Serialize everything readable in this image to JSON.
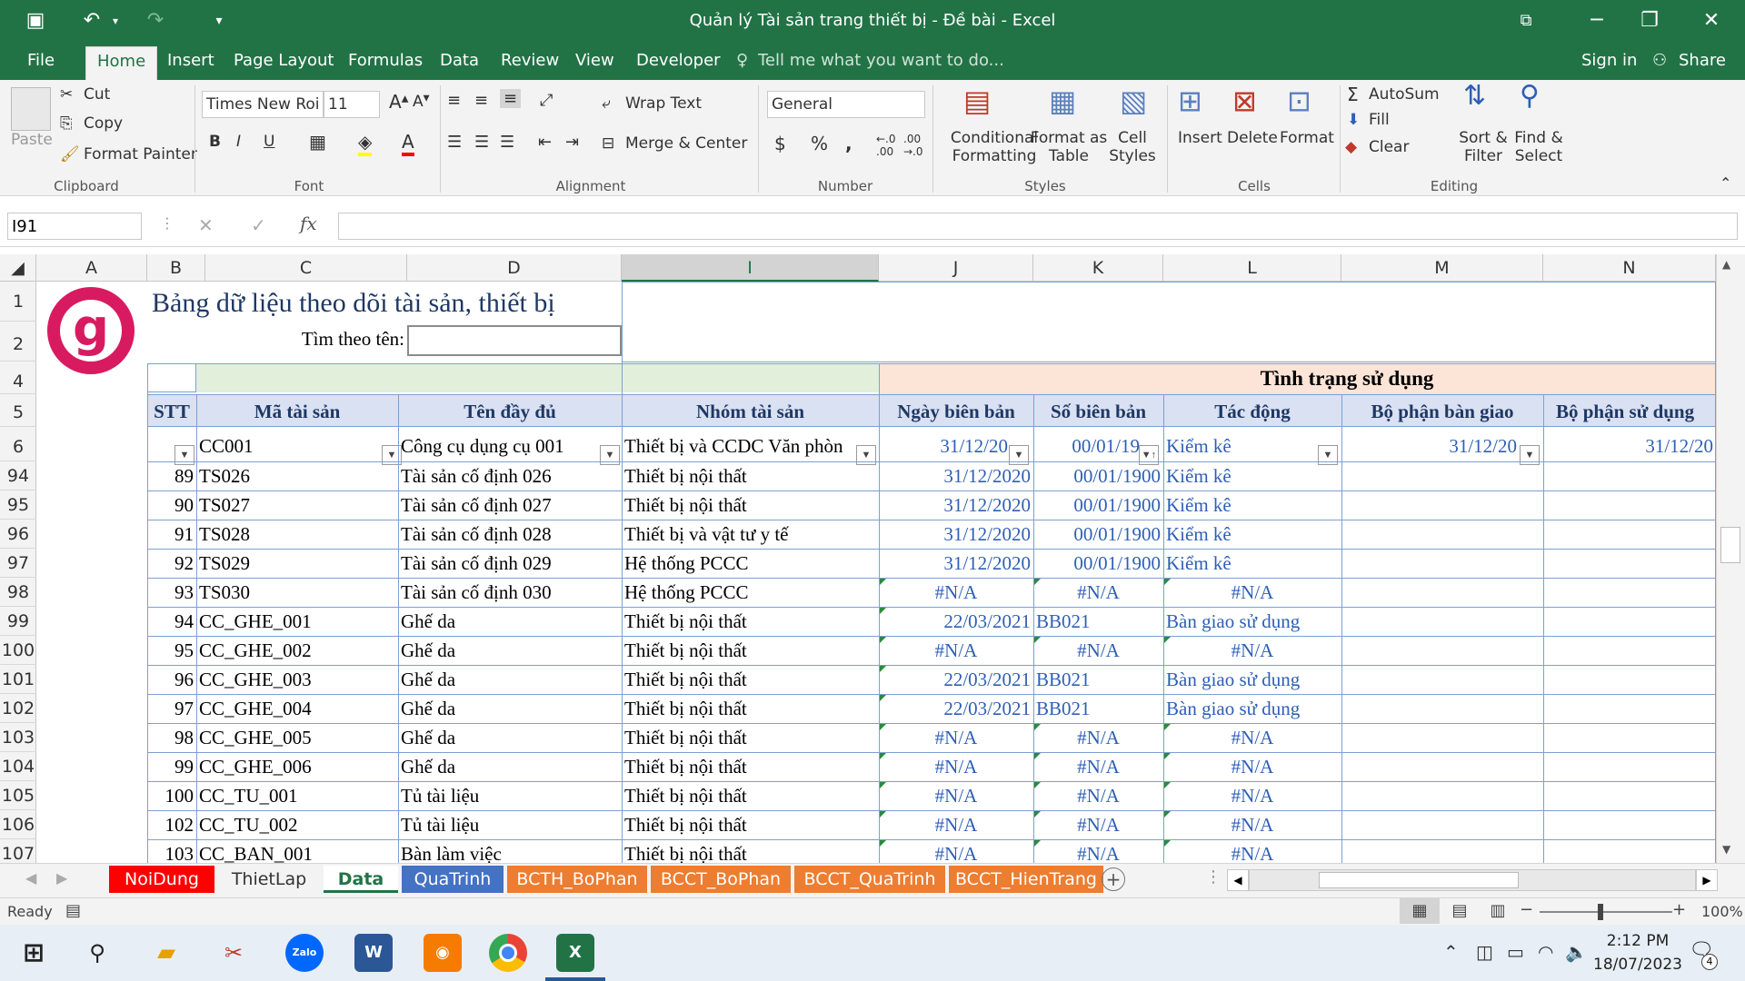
{
  "window": {
    "title": "Quản lý Tài sản trang thiết bị - Đề bài - Excel"
  },
  "menu": {
    "file": "File",
    "home": "Home",
    "insert": "Insert",
    "page_layout": "Page Layout",
    "formulas": "Formulas",
    "data": "Data",
    "review": "Review",
    "view": "View",
    "developer": "Developer",
    "tell_me": "Tell me what you want to do...",
    "sign_in": "Sign in",
    "share": "Share"
  },
  "ribbon": {
    "clipboard": {
      "paste": "Paste",
      "cut": "Cut",
      "copy": "Copy",
      "format_painter": "Format Painter",
      "label": "Clipboard"
    },
    "font": {
      "name": "Times New Roi",
      "size": "11",
      "bold": "B",
      "italic": "I",
      "underline": "U",
      "label": "Font"
    },
    "alignment": {
      "wrap_text": "Wrap Text",
      "merge_center": "Merge & Center",
      "label": "Alignment"
    },
    "number": {
      "format": "General",
      "currency": "$",
      "percent": "%",
      "comma": ",",
      "label": "Number"
    },
    "styles": {
      "conditional": "Conditional",
      "conditional2": "Formatting",
      "format_table": "Format as",
      "format_table2": "Table",
      "cell_styles": "Cell",
      "cell_styles2": "Styles",
      "label": "Styles"
    },
    "cells": {
      "insert": "Insert",
      "delete": "Delete",
      "format": "Format",
      "label": "Cells"
    },
    "editing": {
      "autosum": "AutoSum",
      "fill": "Fill",
      "clear": "Clear",
      "sort": "Sort &",
      "sort2": "Filter",
      "find": "Find &",
      "find2": "Select",
      "label": "Editing"
    }
  },
  "formula_bar": {
    "name_box": "I91",
    "fx": "fx",
    "value": ""
  },
  "columns": [
    "A",
    "B",
    "C",
    "D",
    "I",
    "J",
    "K",
    "L",
    "M",
    "N"
  ],
  "rows": [
    "1",
    "2",
    "4",
    "5",
    "6",
    "94",
    "95",
    "96",
    "97",
    "98",
    "99",
    "100",
    "101",
    "102",
    "103",
    "104",
    "105",
    "106",
    "107"
  ],
  "sheet": {
    "title": "Bảng dữ liệu theo dõi tài sản, thiết bị",
    "search_label": "Tìm theo tên:",
    "status_header": "Tình trạng sử dụng",
    "headers": [
      "STT",
      "Mã tài sản",
      "Tên đầy đủ",
      "Nhóm tài sản",
      "Ngày biên bản",
      "Số biên bản",
      "Tác động",
      "Bộ phận bàn giao",
      "Bộ phận sử dụng"
    ],
    "filter_row": [
      "",
      "CC001",
      "Công cụ dụng cụ 001",
      "Thiết bị và CCDC Văn phòn",
      "31/12/20",
      "00/01/19",
      "Kiểm kê",
      "31/12/20",
      "31/12/20"
    ],
    "data": [
      [
        "89",
        "TS026",
        "Tài sản cố định 026",
        "Thiết bị nội thất",
        "31/12/2020",
        "00/01/1900",
        "Kiểm kê"
      ],
      [
        "90",
        "TS027",
        "Tài sản cố định 027",
        "Thiết bị nội thất",
        "31/12/2020",
        "00/01/1900",
        "Kiểm kê"
      ],
      [
        "91",
        "TS028",
        "Tài sản cố định 028",
        "Thiết bị và vật tư y tế",
        "31/12/2020",
        "00/01/1900",
        "Kiểm kê"
      ],
      [
        "92",
        "TS029",
        "Tài sản cố định 029",
        "Hệ thống PCCC",
        "31/12/2020",
        "00/01/1900",
        "Kiểm kê"
      ],
      [
        "93",
        "TS030",
        "Tài sản cố định 030",
        "Hệ thống PCCC",
        "#N/A",
        "#N/A",
        "#N/A"
      ],
      [
        "94",
        "CC_GHE_001",
        "Ghế da",
        "Thiết bị nội thất",
        "22/03/2021",
        "BB021",
        "Bàn giao sử dụng"
      ],
      [
        "95",
        "CC_GHE_002",
        "Ghế da",
        "Thiết bị nội thất",
        "#N/A",
        "#N/A",
        "#N/A"
      ],
      [
        "96",
        "CC_GHE_003",
        "Ghế da",
        "Thiết bị nội thất",
        "22/03/2021",
        "BB021",
        "Bàn giao sử dụng"
      ],
      [
        "97",
        "CC_GHE_004",
        "Ghế da",
        "Thiết bị nội thất",
        "22/03/2021",
        "BB021",
        "Bàn giao sử dụng"
      ],
      [
        "98",
        "CC_GHE_005",
        "Ghế da",
        "Thiết bị nội thất",
        "#N/A",
        "#N/A",
        "#N/A"
      ],
      [
        "99",
        "CC_GHE_006",
        "Ghế da",
        "Thiết bị nội thất",
        "#N/A",
        "#N/A",
        "#N/A"
      ],
      [
        "100",
        "CC_TU_001",
        "Tủ tài liệu",
        "Thiết bị nội thất",
        "#N/A",
        "#N/A",
        "#N/A"
      ],
      [
        "102",
        "CC_TU_002",
        "Tủ tài liệu",
        "Thiết bị nội thất",
        "#N/A",
        "#N/A",
        "#N/A"
      ],
      [
        "103",
        "CC_BAN_001",
        "Bàn làm việc",
        "Thiết bị nội thất",
        "#N/A",
        "#N/A",
        "#N/A"
      ]
    ]
  },
  "tabs": [
    {
      "label": "NoiDung",
      "bg": "#ff0000",
      "fg": "#ffffff"
    },
    {
      "label": "ThietLap",
      "bg": "#f3f3f3",
      "fg": "#333333"
    },
    {
      "label": "Data",
      "bg": "#ffffff",
      "fg": "#217346"
    },
    {
      "label": "QuaTrinh",
      "bg": "#4472c4",
      "fg": "#ffffff"
    },
    {
      "label": "BCTH_BoPhan",
      "bg": "#ed7d31",
      "fg": "#ffffff"
    },
    {
      "label": "BCCT_BoPhan",
      "bg": "#ed7d31",
      "fg": "#ffffff"
    },
    {
      "label": "BCCT_QuaTrinh",
      "bg": "#ed7d31",
      "fg": "#ffffff"
    },
    {
      "label": "BCCT_HienTrang",
      "bg": "#ed7d31",
      "fg": "#ffffff"
    }
  ],
  "status": {
    "ready": "Ready",
    "zoom": "100%"
  },
  "taskbar": {
    "time": "2:12 PM",
    "date": "18/07/2023",
    "notif": "4",
    "zalo": "Zalo"
  },
  "colors": {
    "excel_green": "#217346",
    "value_blue": "#2e5fb5",
    "header_blue": "#d9e1f2",
    "header_green": "#e2efda",
    "header_peach": "#fce4d6"
  }
}
